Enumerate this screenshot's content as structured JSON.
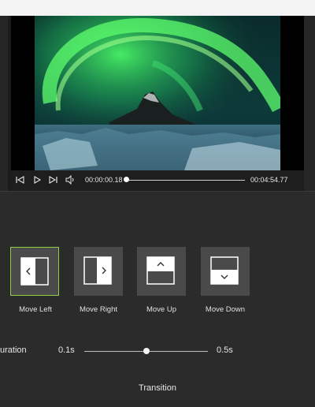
{
  "player": {
    "current_time": "00:00:00.18",
    "total_time": "00:04:54.77",
    "progress_fraction": 0.0006
  },
  "transitions": [
    {
      "label": "Move Left",
      "selected": true
    },
    {
      "label": "Move Right",
      "selected": false
    },
    {
      "label": "Move Up",
      "selected": false
    },
    {
      "label": "Move Down",
      "selected": false
    }
  ],
  "duration": {
    "label": "uration",
    "min_label": "0.1s",
    "max_label": "0.5s",
    "value_fraction": 0.5
  },
  "section_title": "Transition",
  "colors": {
    "selected_border": "#8fce3c",
    "tile_bg": "#4a4a4a",
    "background": "#2b2b2b"
  }
}
